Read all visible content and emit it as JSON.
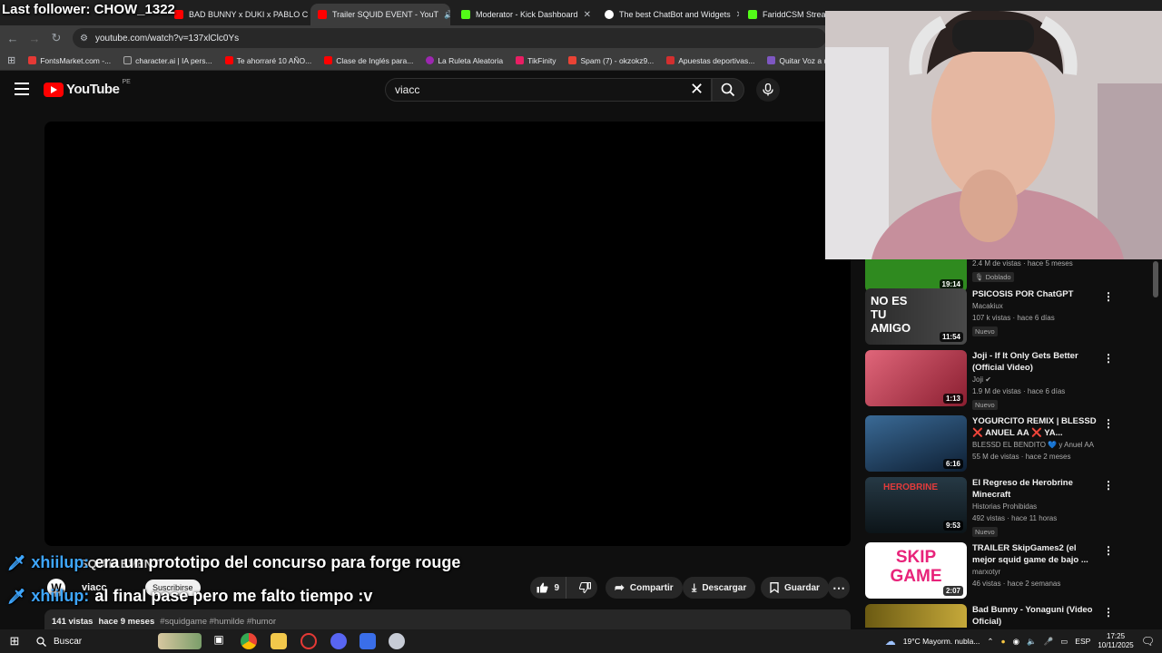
{
  "stream_overlay": {
    "last_follower": "Last follower: CHOW_1322",
    "chat": [
      {
        "user": "xhiilup:",
        "message": "era un prototipo del concurso para forge rouge"
      },
      {
        "user": "xhiilup:",
        "message": "al final pase pero me falto tiempo :v"
      }
    ]
  },
  "browser": {
    "tabs": [
      {
        "label": "BAD BUNNY x DUKI x PABLO C",
        "favicon_color": "#ff0000"
      },
      {
        "label": "Trailer SQUID EVENT - YouT",
        "favicon_color": "#ff0000",
        "active": true
      },
      {
        "label": "Moderator - Kick Dashboard",
        "favicon_color": "#53fc18"
      },
      {
        "label": "The best ChatBot and Widgets",
        "favicon_color": "#ffffff"
      },
      {
        "label": "FariddCSM Stream - W",
        "favicon_color": "#53fc18"
      }
    ],
    "url": "youtube.com/watch?v=137xlClc0Ys",
    "bookmarks": [
      {
        "label": "FontsMarket.com -...",
        "icon_color": "#e53935"
      },
      {
        "label": "character.ai | IA pers...",
        "icon_color": "#444444"
      },
      {
        "label": "Te ahorraré 10 AÑO...",
        "icon_color": "#ff0000"
      },
      {
        "label": "Clase de Inglés para...",
        "icon_color": "#ff0000"
      },
      {
        "label": "La Ruleta Aleatoria",
        "icon_color": "#9c27b0"
      },
      {
        "label": "TikFinity",
        "icon_color": "#e91e63"
      },
      {
        "label": "Spam (7) - okzokz9...",
        "icon_color": "#ea4335"
      },
      {
        "label": "Apuestas deportivas...",
        "icon_color": "#d32f2f"
      },
      {
        "label": "Quitar Voz a una Ca...",
        "icon_color": "#7e57c2"
      }
    ]
  },
  "youtube": {
    "logo_text": "YouTube",
    "region": "PE",
    "search_value": "viacc",
    "video": {
      "title": "SQUID EVENT",
      "channel": "viacc",
      "subscribe_label": "Suscribirse",
      "likes": "9",
      "share_label": "Compartir",
      "download_label": "Descargar",
      "save_label": "Guardar",
      "views": "141 vistas",
      "age": "hace 9 meses",
      "tags": "#squidgame #humilde #humor"
    },
    "recommendations": [
      {
        "title": "",
        "channel": "",
        "meta": "2.4 M de vistas · hace 5 meses",
        "badge": "Doblado",
        "duration": "19:14",
        "thumb": "#2f8a1f"
      },
      {
        "title": "PSICOSIS POR ChatGPT",
        "channel": "Macakiux",
        "meta": "107 k vistas · hace 6 días",
        "badge": "Nuevo",
        "duration": "11:54",
        "thumb": "#3a3a3a",
        "thumb_text": "NO ES TU AMIGO"
      },
      {
        "title": "Joji - If It Only Gets Better (Official Video)",
        "channel": "Joji",
        "meta": "1.9 M de vistas · hace 6 días",
        "badge": "Nuevo",
        "duration": "1:13",
        "thumb": "#c0394f"
      },
      {
        "title": "YOGURCITO REMIX | BLESSD ❌ ANUEL AA ❌ YA...",
        "channel": "BLESSD EL BENDITO 💙 y Anuel AA",
        "meta": "55 M de vistas · hace 2 meses",
        "badge": "",
        "duration": "6:16",
        "thumb": "#1d3b5c"
      },
      {
        "title": "El Regreso de Herobrine Minecraft",
        "channel": "Historias Prohibidas",
        "meta": "492 vistas · hace 11 horas",
        "badge": "Nuevo",
        "duration": "9:53",
        "thumb": "#1c2a33",
        "thumb_text": "HEROBRINE"
      },
      {
        "title": "TRAILER SkipGames2 (el mejor squid game de bajo ...",
        "channel": "marxotyr",
        "meta": "46 vistas · hace 2 semanas",
        "badge": "",
        "duration": "2:07",
        "thumb": "#ffffff",
        "thumb_text": "SKIP GAME"
      },
      {
        "title": "Bad Bunny - Yonaguni (Video Oficial)",
        "channel": "",
        "meta": "",
        "badge": "",
        "duration": "",
        "thumb": "#6b5a12"
      }
    ]
  },
  "taskbar": {
    "search_label": "Buscar",
    "weather": "19°C  Mayorm. nubla...",
    "language": "ESP",
    "time": "17:25",
    "date": "10/11/2025"
  }
}
